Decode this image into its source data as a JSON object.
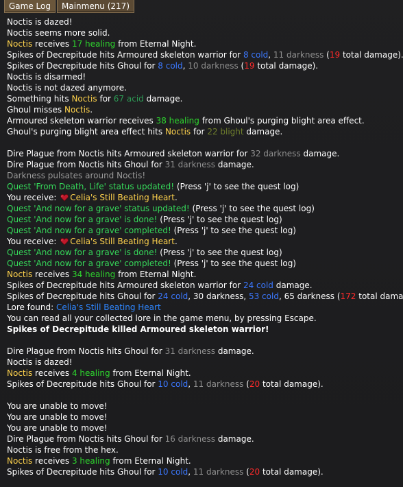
{
  "tabs": [
    {
      "label": "Game Log",
      "active": true
    },
    {
      "label": "Mainmenu (217)",
      "active": false
    }
  ],
  "colors": {
    "name": "#ffd34d",
    "healing": "#2ed62e",
    "cold": "#3b78ff",
    "darkness": "#8f8f8f",
    "total_damage": "#ff2a2a",
    "acid": "#2d9a55",
    "blight": "#6f7f2c",
    "quest": "#36d85a",
    "lore": "#2e86ff"
  },
  "log_lines": [
    {
      "segments": [
        {
          "t": "Noctis is dazed!",
          "c": "white"
        }
      ]
    },
    {
      "segments": [
        {
          "t": "Noctis seems more solid.",
          "c": "white"
        }
      ]
    },
    {
      "segments": [
        {
          "t": "Noctis",
          "c": "gold"
        },
        {
          "t": " receives ",
          "c": "white"
        },
        {
          "t": "17 healing",
          "c": "heal"
        },
        {
          "t": " from Eternal Night.",
          "c": "white"
        }
      ]
    },
    {
      "segments": [
        {
          "t": "Spikes of Decrepitude hits Armoured skeleton warrior for ",
          "c": "white"
        },
        {
          "t": "8 cold",
          "c": "cold"
        },
        {
          "t": ", ",
          "c": "white"
        },
        {
          "t": "11 darkness",
          "c": "dark"
        },
        {
          "t": " (",
          "c": "white"
        },
        {
          "t": "19",
          "c": "red"
        },
        {
          "t": " total damage).",
          "c": "white"
        }
      ]
    },
    {
      "segments": [
        {
          "t": "Spikes of Decrepitude hits Ghoul for ",
          "c": "white"
        },
        {
          "t": "8 cold",
          "c": "cold"
        },
        {
          "t": ", ",
          "c": "white"
        },
        {
          "t": "10 darkness",
          "c": "dark"
        },
        {
          "t": " (",
          "c": "white"
        },
        {
          "t": "19",
          "c": "red"
        },
        {
          "t": " total damage).",
          "c": "white"
        }
      ]
    },
    {
      "segments": [
        {
          "t": "Noctis is disarmed!",
          "c": "white"
        }
      ]
    },
    {
      "segments": [
        {
          "t": "Noctis is not dazed anymore.",
          "c": "white"
        }
      ]
    },
    {
      "segments": [
        {
          "t": "Something hits ",
          "c": "white"
        },
        {
          "t": "Noctis",
          "c": "gold"
        },
        {
          "t": " for ",
          "c": "white"
        },
        {
          "t": "67 acid",
          "c": "acid"
        },
        {
          "t": " damage.",
          "c": "white"
        }
      ]
    },
    {
      "segments": [
        {
          "t": "Ghoul misses ",
          "c": "white"
        },
        {
          "t": "Noctis",
          "c": "gold"
        },
        {
          "t": ".",
          "c": "white"
        }
      ]
    },
    {
      "segments": [
        {
          "t": "Armoured skeleton warrior receives ",
          "c": "white"
        },
        {
          "t": "38 healing",
          "c": "heal"
        },
        {
          "t": " from Ghoul's purging blight area effect.",
          "c": "white"
        }
      ]
    },
    {
      "segments": [
        {
          "t": "Ghoul's purging blight area effect hits ",
          "c": "white"
        },
        {
          "t": "Noctis",
          "c": "gold"
        },
        {
          "t": " for ",
          "c": "white"
        },
        {
          "t": "22 blight",
          "c": "blight"
        },
        {
          "t": " damage.",
          "c": "white"
        }
      ]
    },
    {
      "segments": []
    },
    {
      "segments": [
        {
          "t": "Dire Plague from Noctis hits Armoured skeleton warrior for ",
          "c": "white"
        },
        {
          "t": "32 darkness",
          "c": "dark"
        },
        {
          "t": " damage.",
          "c": "white"
        }
      ]
    },
    {
      "segments": [
        {
          "t": "Dire Plague from Noctis hits Ghoul for ",
          "c": "white"
        },
        {
          "t": "31 darkness",
          "c": "dark"
        },
        {
          "t": " damage.",
          "c": "white"
        }
      ]
    },
    {
      "segments": [
        {
          "t": "Darkness pulsates around Noctis!",
          "c": "grey"
        }
      ]
    },
    {
      "segments": [
        {
          "t": "Quest 'From Death, Life' status updated!",
          "c": "quest"
        },
        {
          "t": " (Press 'j' to see the quest log)",
          "c": "white"
        }
      ]
    },
    {
      "segments": [
        {
          "t": "You receive: ",
          "c": "white"
        },
        {
          "icon": "heart-icon"
        },
        {
          "t": "Celia's Still Beating Heart",
          "c": "gold"
        },
        {
          "t": ".",
          "c": "white"
        }
      ]
    },
    {
      "segments": [
        {
          "t": "Quest 'And now for a grave' status updated!",
          "c": "quest"
        },
        {
          "t": " (Press 'j' to see the quest log)",
          "c": "white"
        }
      ]
    },
    {
      "segments": [
        {
          "t": "Quest 'And now for a grave' is done!",
          "c": "quest"
        },
        {
          "t": " (Press 'j' to see the quest log)",
          "c": "white"
        }
      ]
    },
    {
      "segments": [
        {
          "t": "Quest 'And now for a grave' completed!",
          "c": "quest"
        },
        {
          "t": " (Press 'j' to see the quest log)",
          "c": "white"
        }
      ]
    },
    {
      "segments": [
        {
          "t": "You receive: ",
          "c": "white"
        },
        {
          "icon": "heart-icon"
        },
        {
          "t": "Celia's Still Beating Heart",
          "c": "gold"
        },
        {
          "t": ".",
          "c": "white"
        }
      ]
    },
    {
      "segments": [
        {
          "t": "Quest 'And now for a grave' is done!",
          "c": "quest"
        },
        {
          "t": " (Press 'j' to see the quest log)",
          "c": "white"
        }
      ]
    },
    {
      "segments": [
        {
          "t": "Quest 'And now for a grave' completed!",
          "c": "quest"
        },
        {
          "t": " (Press 'j' to see the quest log)",
          "c": "white"
        }
      ]
    },
    {
      "segments": [
        {
          "t": "Noctis",
          "c": "gold"
        },
        {
          "t": " receives ",
          "c": "white"
        },
        {
          "t": "34 healing",
          "c": "heal"
        },
        {
          "t": " from Eternal Night.",
          "c": "white"
        }
      ]
    },
    {
      "segments": [
        {
          "t": "Spikes of Decrepitude hits Armoured skeleton warrior for ",
          "c": "white"
        },
        {
          "t": "24 cold",
          "c": "cold"
        },
        {
          "t": " damage.",
          "c": "white"
        }
      ]
    },
    {
      "segments": [
        {
          "t": "Spikes of Decrepitude hits Ghoul for ",
          "c": "white"
        },
        {
          "t": "24 cold",
          "c": "cold"
        },
        {
          "t": ", 30 darkness, ",
          "c": "white"
        },
        {
          "t": "53 cold",
          "c": "cold"
        },
        {
          "t": ", 65 darkness",
          "c": "white"
        },
        {
          "t": " (",
          "c": "white"
        },
        {
          "t": "172",
          "c": "red"
        },
        {
          "t": " total damage).",
          "c": "white"
        }
      ]
    },
    {
      "segments": [
        {
          "t": "Lore found: ",
          "c": "white"
        },
        {
          "t": "Celia's Still Beating Heart",
          "c": "lore"
        }
      ]
    },
    {
      "segments": [
        {
          "t": "You can read all your collected lore in the game menu, by pressing Escape.",
          "c": "white"
        }
      ]
    },
    {
      "bold": true,
      "segments": [
        {
          "t": "Spikes of Decrepitude killed Armoured skeleton warrior!",
          "c": "white"
        }
      ]
    },
    {
      "segments": []
    },
    {
      "segments": [
        {
          "t": "Dire Plague from Noctis hits Ghoul for ",
          "c": "white"
        },
        {
          "t": "31 darkness",
          "c": "dark"
        },
        {
          "t": " damage.",
          "c": "white"
        }
      ]
    },
    {
      "segments": [
        {
          "t": "Noctis is dazed!",
          "c": "white"
        }
      ]
    },
    {
      "segments": [
        {
          "t": "Noctis",
          "c": "gold"
        },
        {
          "t": " receives ",
          "c": "white"
        },
        {
          "t": "4 healing",
          "c": "heal"
        },
        {
          "t": " from Eternal Night.",
          "c": "white"
        }
      ]
    },
    {
      "segments": [
        {
          "t": "Spikes of Decrepitude hits Ghoul for ",
          "c": "white"
        },
        {
          "t": "10 cold",
          "c": "cold"
        },
        {
          "t": ", ",
          "c": "white"
        },
        {
          "t": "11 darkness",
          "c": "dark"
        },
        {
          "t": " (",
          "c": "white"
        },
        {
          "t": "20",
          "c": "red"
        },
        {
          "t": " total damage).",
          "c": "white"
        }
      ]
    },
    {
      "segments": []
    },
    {
      "segments": [
        {
          "t": "You are unable to move!",
          "c": "white"
        }
      ]
    },
    {
      "segments": [
        {
          "t": "You are unable to move!",
          "c": "white"
        }
      ]
    },
    {
      "segments": [
        {
          "t": "You are unable to move!",
          "c": "white"
        }
      ]
    },
    {
      "segments": [
        {
          "t": "Dire Plague from Noctis hits Ghoul for ",
          "c": "white"
        },
        {
          "t": "16 darkness",
          "c": "dark"
        },
        {
          "t": " damage.",
          "c": "white"
        }
      ]
    },
    {
      "segments": [
        {
          "t": "Noctis is free from the hex.",
          "c": "white"
        }
      ]
    },
    {
      "segments": [
        {
          "t": "Noctis",
          "c": "gold"
        },
        {
          "t": " receives ",
          "c": "white"
        },
        {
          "t": "3 healing",
          "c": "heal"
        },
        {
          "t": " from Eternal Night.",
          "c": "white"
        }
      ]
    },
    {
      "segments": [
        {
          "t": "Spikes of Decrepitude hits Ghoul for ",
          "c": "white"
        },
        {
          "t": "10 cold",
          "c": "cold"
        },
        {
          "t": ", ",
          "c": "white"
        },
        {
          "t": "11 darkness",
          "c": "dark"
        },
        {
          "t": " (",
          "c": "white"
        },
        {
          "t": "20",
          "c": "red"
        },
        {
          "t": " total damage).",
          "c": "white"
        }
      ]
    }
  ]
}
